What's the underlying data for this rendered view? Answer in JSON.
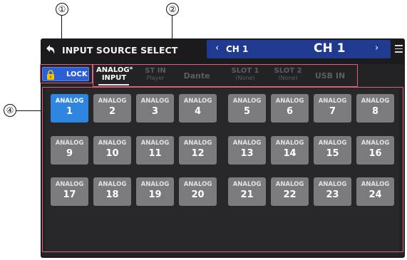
{
  "callouts": {
    "c1": "①",
    "c2": "②",
    "c4": "④"
  },
  "header": {
    "title": "INPUT SOURCE SELECT",
    "prev_icon": "‹",
    "prev_channel": "CH 1",
    "channel_name": "CH 1",
    "next_icon": "›"
  },
  "lock": {
    "label": "LOCK"
  },
  "tabs": [
    {
      "line1": "ANALOG",
      "line2": "INPUT",
      "star": "*"
    },
    {
      "line1": "ST IN",
      "line2": "Player"
    },
    {
      "line1": "Dante",
      "line2": ""
    },
    {
      "line1": "SLOT 1",
      "line2": "(None)"
    },
    {
      "line1": "SLOT 2",
      "line2": "(None)"
    },
    {
      "line1": "USB IN",
      "line2": ""
    }
  ],
  "sources": [
    {
      "label": "ANALOG",
      "num": "1"
    },
    {
      "label": "ANALOG",
      "num": "2"
    },
    {
      "label": "ANALOG",
      "num": "3"
    },
    {
      "label": "ANALOG",
      "num": "4"
    },
    {
      "label": "ANALOG",
      "num": "5"
    },
    {
      "label": "ANALOG",
      "num": "6"
    },
    {
      "label": "ANALOG",
      "num": "7"
    },
    {
      "label": "ANALOG",
      "num": "8"
    },
    {
      "label": "ANALOG",
      "num": "9"
    },
    {
      "label": "ANALOG",
      "num": "10"
    },
    {
      "label": "ANALOG",
      "num": "11"
    },
    {
      "label": "ANALOG",
      "num": "12"
    },
    {
      "label": "ANALOG",
      "num": "13"
    },
    {
      "label": "ANALOG",
      "num": "14"
    },
    {
      "label": "ANALOG",
      "num": "15"
    },
    {
      "label": "ANALOG",
      "num": "16"
    },
    {
      "label": "ANALOG",
      "num": "17"
    },
    {
      "label": "ANALOG",
      "num": "18"
    },
    {
      "label": "ANALOG",
      "num": "19"
    },
    {
      "label": "ANALOG",
      "num": "20"
    },
    {
      "label": "ANALOG",
      "num": "21"
    },
    {
      "label": "ANALOG",
      "num": "22"
    },
    {
      "label": "ANALOG",
      "num": "23"
    },
    {
      "label": "ANALOG",
      "num": "24"
    }
  ],
  "colors": {
    "accent": "#2f86e0",
    "channel_bar": "#1f3a8e",
    "annotation": "#e0607a"
  },
  "icons": {
    "back": "back-arrow-icon",
    "lock": "padlock-icon",
    "menu": "menu-icon"
  }
}
